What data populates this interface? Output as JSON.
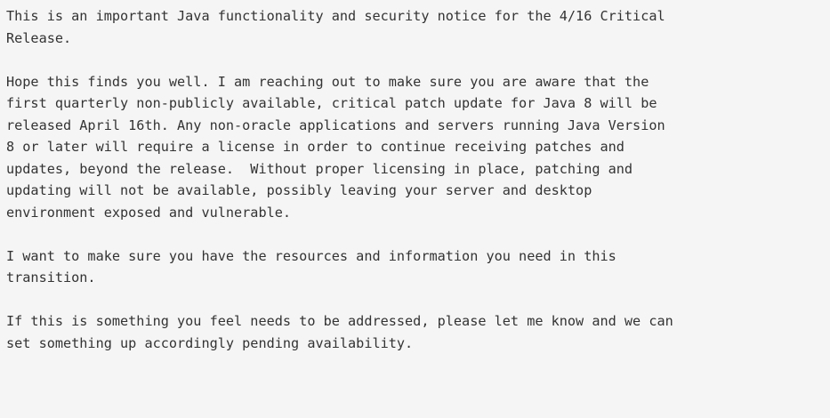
{
  "email": {
    "paragraphs": [
      {
        "lines": [
          "This is an important Java functionality and security notice for the 4/16 Critical",
          "Release."
        ]
      },
      {
        "lines": [
          "Hope this finds you well. I am reaching out to make sure you are aware that the",
          "first quarterly non-publicly available, critical patch update for Java 8 will be",
          "released April 16th. Any non-oracle applications and servers running Java Version",
          "8 or later will require a license in order to continue receiving patches and",
          "updates, beyond the release.  Without proper licensing in place, patching and",
          "updating will not be available, possibly leaving your server and desktop",
          "environment exposed and vulnerable."
        ]
      },
      {
        "lines": [
          "I want to make sure you have the resources and information you need in this",
          "transition."
        ]
      },
      {
        "lines": [
          "If this is something you feel needs to be addressed, please let me know and we can",
          "set something up accordingly pending availability."
        ]
      }
    ]
  }
}
